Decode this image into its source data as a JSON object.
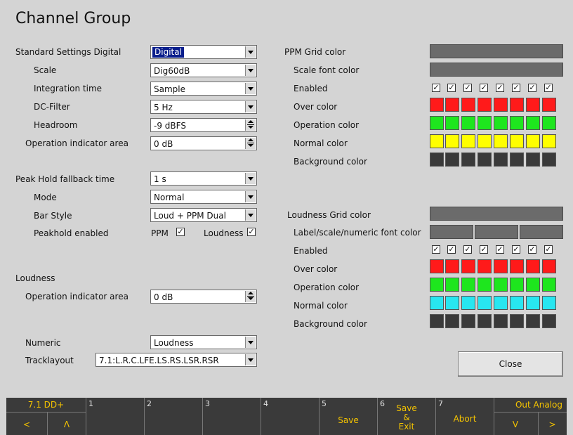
{
  "title": "Channel Group",
  "left": {
    "rows": [
      {
        "label": "Standard Settings Digital",
        "value": "Digital",
        "control": "select-highlight"
      },
      {
        "label": "Scale",
        "value": "Dig60dB",
        "control": "select"
      },
      {
        "label": "Integration time",
        "value": "Sample",
        "control": "select"
      },
      {
        "label": "DC-Filter",
        "value": "5 Hz",
        "control": "select"
      },
      {
        "label": "Headroom",
        "value": "-9 dBFS",
        "control": "spin"
      },
      {
        "label": "Operation indicator area",
        "value": "0 dB",
        "control": "spin"
      },
      {
        "label": "Peak Hold fallback time",
        "value": "1 s",
        "control": "select"
      },
      {
        "label": "Mode",
        "value": "Normal",
        "control": "select"
      },
      {
        "label": "Bar Style",
        "value": "Loud + PPM Dual",
        "control": "select"
      },
      {
        "label": "Peakhold enabled"
      },
      {
        "label": "Loudness"
      },
      {
        "label": "Operation indicator area",
        "value": "0 dB",
        "control": "spin"
      },
      {
        "label": "Numeric",
        "value": "Loudness",
        "control": "select"
      },
      {
        "label": "Tracklayout",
        "value": "7.1:L.R.C.LFE.LS.RS.LSR.RSR",
        "control": "select"
      }
    ],
    "peakhold": {
      "ppm_label": "PPM",
      "ppm_checked": true,
      "loudness_label": "Loudness",
      "loudness_checked": true
    }
  },
  "ppm": {
    "labels": [
      "PPM Grid color",
      "Scale font color",
      "Enabled",
      "Over color",
      "Operation color",
      "Normal color",
      "Background color"
    ],
    "enabled": [
      true,
      true,
      true,
      true,
      true,
      true,
      true,
      true
    ],
    "colors": {
      "grid": "#6b6b6b",
      "over": "#ff1a1a",
      "operation": "#1ee61e",
      "normal": "#ffff00",
      "background": "#3a3a3a"
    }
  },
  "loudness": {
    "labels": [
      "Loudness Grid color",
      "Label/scale/numeric font color",
      "Enabled",
      "Over color",
      "Operation color",
      "Normal color",
      "Background color"
    ],
    "enabled": [
      true,
      true,
      true,
      true,
      true,
      true,
      true,
      true
    ],
    "colors": {
      "grid": "#6b6b6b",
      "over": "#ff1a1a",
      "operation": "#1ee61e",
      "normal": "#28e6f0",
      "background": "#3a3a3a"
    }
  },
  "close_label": "Close",
  "footer": [
    {
      "num": "",
      "top": "7.1 DD+",
      "bottom_left": "<",
      "bottom_right": "Λ"
    },
    {
      "num": "1",
      "text": ""
    },
    {
      "num": "2",
      "text": ""
    },
    {
      "num": "3",
      "text": ""
    },
    {
      "num": "4",
      "text": ""
    },
    {
      "num": "5",
      "text": "Save"
    },
    {
      "num": "6",
      "text": "Save\n&\nExit"
    },
    {
      "num": "7",
      "text": "Abort"
    },
    {
      "num": "",
      "top": "Out Analog",
      "bottom_left": "V",
      "bottom_right": ">"
    }
  ]
}
